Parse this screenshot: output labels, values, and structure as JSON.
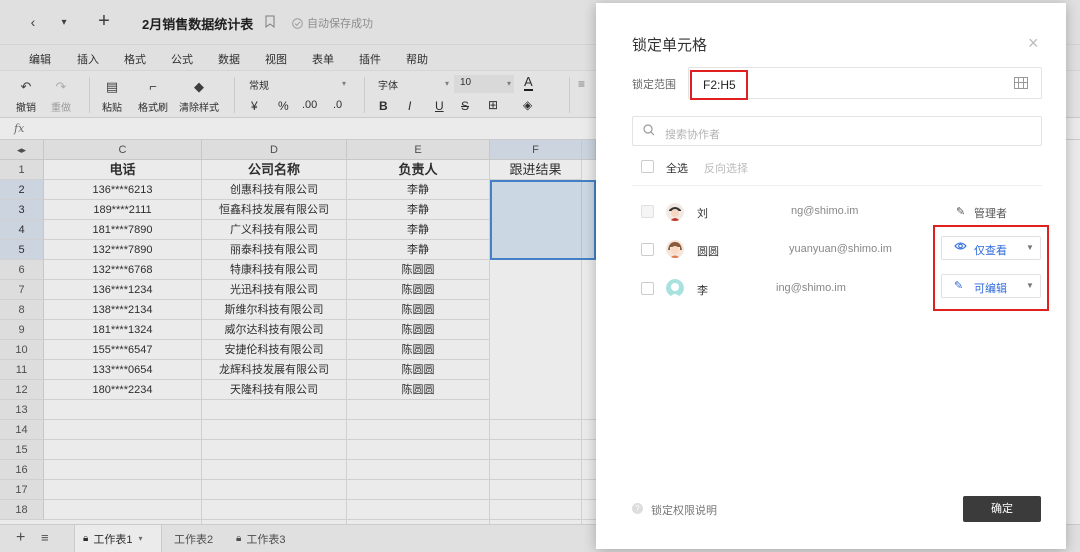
{
  "titlebar": {
    "title": "2月销售数据统计表",
    "autosave": "自动保存成功",
    "new_tab_label": "+",
    "back_label": "‹",
    "more_label": "▾"
  },
  "menu": [
    "编辑",
    "插入",
    "格式",
    "公式",
    "数据",
    "视图",
    "表单",
    "插件",
    "帮助"
  ],
  "toolbar": {
    "undo": "撤销",
    "redo": "重做",
    "paste": "粘贴",
    "format_painter": "格式刷",
    "clear_format": "清除样式",
    "number_format": "常规",
    "currency": "¥",
    "percent": "%",
    "dec_increase": ".00",
    "dec_decrease": ".0",
    "font": "字体",
    "font_size": "10",
    "bold": "B",
    "italic": "I",
    "underline": "U",
    "strike": "S",
    "text_color": "A"
  },
  "formula_bar": {
    "fx_label": "fx"
  },
  "sheet": {
    "columns": [
      "C",
      "D",
      "E",
      "F"
    ],
    "row_numbers": [
      "1",
      "2",
      "3",
      "4",
      "5",
      "6",
      "7",
      "8",
      "9",
      "10",
      "11",
      "12",
      "13",
      "14",
      "15",
      "16",
      "17",
      "18"
    ],
    "header_row": [
      "电话",
      "公司名称",
      "负责人",
      "跟进结果"
    ],
    "rows": [
      [
        "136****6213",
        "创惠科技有限公司",
        "李静",
        ""
      ],
      [
        "189****2111",
        "恒鑫科技发展有限公司",
        "李静",
        ""
      ],
      [
        "181****7890",
        "广义科技有限公司",
        "李静",
        ""
      ],
      [
        "132****7890",
        "丽泰科技有限公司",
        "李静",
        ""
      ],
      [
        "132****6768",
        "特康科技有限公司",
        "陈圆圆",
        ""
      ],
      [
        "136****1234",
        "光迅科技有限公司",
        "陈圆圆",
        ""
      ],
      [
        "138****2134",
        "斯维尔科技有限公司",
        "陈圆圆",
        ""
      ],
      [
        "181****1324",
        "威尔达科技有限公司",
        "陈圆圆",
        ""
      ],
      [
        "155****6547",
        "安捷伦科技有限公司",
        "陈圆圆",
        ""
      ],
      [
        "133****0654",
        "龙辉科技发展有限公司",
        "陈圆圆",
        ""
      ],
      [
        "180****2234",
        "天隆科技有限公司",
        "陈圆圆",
        ""
      ]
    ]
  },
  "sheet_tabs": {
    "add_label": "+",
    "list_label": "≡",
    "tabs": [
      "工作表1",
      "工作表2",
      "工作表3"
    ]
  },
  "dialog": {
    "title": "锁定单元格",
    "close_label": "×",
    "range_label": "锁定范围",
    "range_value": "F2:H5",
    "search_placeholder": "搜索协作者",
    "select_all": "全选",
    "invert_select": "反向选择",
    "users": [
      {
        "name": "刘",
        "email": "ng@shimo.im",
        "role": "管理者"
      },
      {
        "name": "圆圆",
        "email": "yuanyuan@shimo.im",
        "permission": "仅查看"
      },
      {
        "name": "李",
        "email": "ing@shimo.im",
        "permission": "可编辑"
      }
    ],
    "help_text": "锁定权限说明",
    "ok_label": "确定"
  },
  "colors": {
    "selection": "#4a8bd6",
    "highlight_red": "#e02020",
    "link_blue": "#2f6bd8",
    "ok_button": "#3b3b3b"
  }
}
